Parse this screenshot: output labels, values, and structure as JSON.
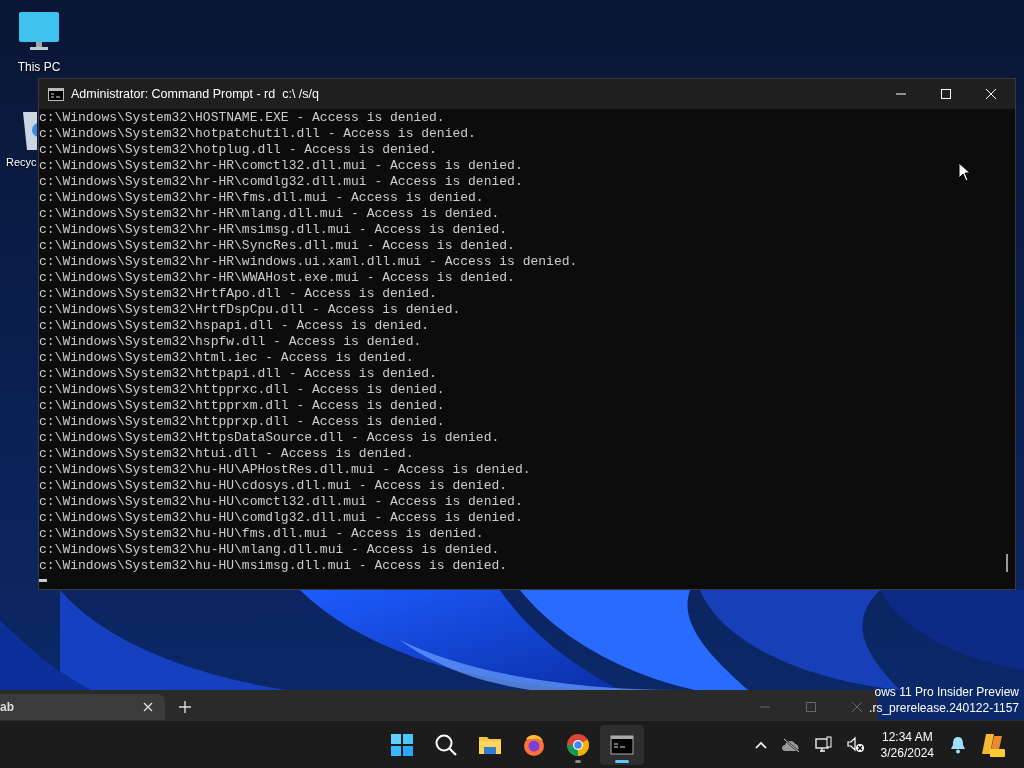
{
  "desktop": {
    "icons": [
      {
        "kind": "computer",
        "label": "This PC"
      },
      {
        "kind": "recycle",
        "label": "Recyc"
      }
    ]
  },
  "console": {
    "title": "Administrator: Command Prompt - rd  c:\\ /s/q",
    "lines": [
      "c:\\Windows\\System32\\HOSTNAME.EXE - Access is denied.",
      "c:\\Windows\\System32\\hotpatchutil.dll - Access is denied.",
      "c:\\Windows\\System32\\hotplug.dll - Access is denied.",
      "c:\\Windows\\System32\\hr-HR\\comctl32.dll.mui - Access is denied.",
      "c:\\Windows\\System32\\hr-HR\\comdlg32.dll.mui - Access is denied.",
      "c:\\Windows\\System32\\hr-HR\\fms.dll.mui - Access is denied.",
      "c:\\Windows\\System32\\hr-HR\\mlang.dll.mui - Access is denied.",
      "c:\\Windows\\System32\\hr-HR\\msimsg.dll.mui - Access is denied.",
      "c:\\Windows\\System32\\hr-HR\\SyncRes.dll.mui - Access is denied.",
      "c:\\Windows\\System32\\hr-HR\\windows.ui.xaml.dll.mui - Access is denied.",
      "c:\\Windows\\System32\\hr-HR\\WWAHost.exe.mui - Access is denied.",
      "c:\\Windows\\System32\\HrtfApo.dll - Access is denied.",
      "c:\\Windows\\System32\\HrtfDspCpu.dll - Access is denied.",
      "c:\\Windows\\System32\\hspapi.dll - Access is denied.",
      "c:\\Windows\\System32\\hspfw.dll - Access is denied.",
      "c:\\Windows\\System32\\html.iec - Access is denied.",
      "c:\\Windows\\System32\\httpapi.dll - Access is denied.",
      "c:\\Windows\\System32\\httpprxc.dll - Access is denied.",
      "c:\\Windows\\System32\\httpprxm.dll - Access is denied.",
      "c:\\Windows\\System32\\httpprxp.dll - Access is denied.",
      "c:\\Windows\\System32\\HttpsDataSource.dll - Access is denied.",
      "c:\\Windows\\System32\\htui.dll - Access is denied.",
      "c:\\Windows\\System32\\hu-HU\\APHostRes.dll.mui - Access is denied.",
      "c:\\Windows\\System32\\hu-HU\\cdosys.dll.mui - Access is denied.",
      "c:\\Windows\\System32\\hu-HU\\comctl32.dll.mui - Access is denied.",
      "c:\\Windows\\System32\\hu-HU\\comdlg32.dll.mui - Access is denied.",
      "c:\\Windows\\System32\\hu-HU\\fms.dll.mui - Access is denied.",
      "c:\\Windows\\System32\\hu-HU\\mlang.dll.mui - Access is denied.",
      "c:\\Windows\\System32\\hu-HU\\msimsg.dll.mui - Access is denied."
    ]
  },
  "browser_window": {
    "tab_label": "ab"
  },
  "watermark": [
    "ows 11 Pro Insider Preview",
    ".rs_prerelease.240122-1157"
  ],
  "taskbar": {
    "apps": [
      {
        "kind": "start",
        "running": false,
        "selected": false
      },
      {
        "kind": "search",
        "running": false,
        "selected": false
      },
      {
        "kind": "explorer",
        "running": false,
        "selected": false
      },
      {
        "kind": "firefox",
        "running": false,
        "selected": false
      },
      {
        "kind": "chrome",
        "running": true,
        "selected": false
      },
      {
        "kind": "terminal",
        "running": true,
        "selected": true
      }
    ],
    "time": "12:34 AM",
    "date": "3/26/2024"
  }
}
